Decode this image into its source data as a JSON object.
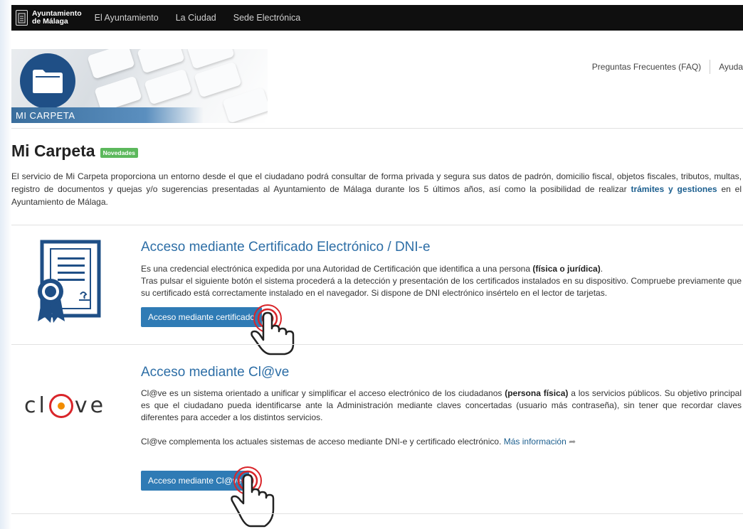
{
  "topbar": {
    "brand_line1": "Ayuntamiento",
    "brand_line2": "de Málaga",
    "nav": [
      "El Ayuntamiento",
      "La Ciudad",
      "Sede Electrónica"
    ]
  },
  "header": {
    "banner_label": "MI CARPETA",
    "links": [
      "Preguntas Frecuentes (FAQ)",
      "Ayuda"
    ]
  },
  "page": {
    "title": "Mi Carpeta",
    "badge": "Novedades",
    "intro_text": "El servicio de Mi Carpeta proporciona un entorno desde el que el ciudadano podrá consultar de forma privada y segura sus datos de padrón, domicilio fiscal, objetos fiscales, tributos, multas, registro de documentos y quejas y/o sugerencias presentadas al Ayuntamiento de Málaga durante los 5 últimos años, así como la posibilidad de realizar ",
    "intro_link": "trámites y gestiones",
    "intro_tail": " en el Ayuntamiento de Málaga."
  },
  "certificate": {
    "title": "Acceso mediante Certificado Electrónico / DNI-e",
    "line1_pre": "Es una credencial electrónica expedida por una Autoridad de Certificación que identifica a una persona ",
    "line1_bold": "(física o jurídica)",
    "line1_post": ".",
    "line2": "Tras pulsar el siguiente botón el sistema procederá a la detección y presentación de los certificados instalados en su dispositivo. Compruebe previamente que su certificado está correctamente instalado en el navegador. Si dispone de DNI electrónico insértelo en el lector de tarjetas.",
    "button": "Acceso mediante certificado"
  },
  "clave": {
    "logo_pre": "cl",
    "logo_post": "ve",
    "title": "Acceso mediante Cl@ve",
    "p1_pre": "Cl@ve es un sistema orientado a unificar y simplificar el acceso electrónico de los ciudadanos ",
    "p1_bold": "(persona física)",
    "p1_post": " a los servicios públicos. Su objetivo principal es que el ciudadano pueda identificarse ante la Administración mediante claves concertadas (usuario más contraseña), sin tener que recordar claves diferentes para acceder a los distintos servicios.",
    "p2": "Cl@ve complementa los actuales sistemas de acceso mediante DNI-e y certificado electrónico. ",
    "more_link": "Más información",
    "button": "Acceso mediante Cl@ve"
  },
  "colors": {
    "accent": "#2f7bb5",
    "title_blue": "#2d6ea6",
    "badge_green": "#5cb85c",
    "icon_navy": "#1f4f86",
    "hand_red": "#d9252a"
  }
}
